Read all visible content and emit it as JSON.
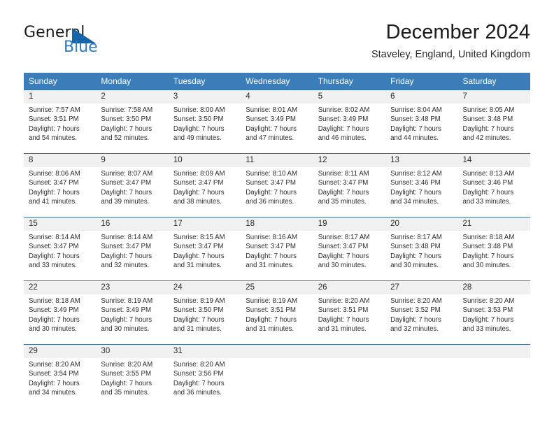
{
  "brand": {
    "word_one": "General",
    "word_two": "Blue",
    "triangle_icon": "brand-triangle-icon"
  },
  "header": {
    "title": "December 2024",
    "location": "Staveley, England, United Kingdom"
  },
  "theme": {
    "header_blue": "#3b7db9",
    "row_rule": "#41719c",
    "daynum_band": "#f0f0f0",
    "brand_blue": "#2b7cc4",
    "brand_triangle": "#1565a8"
  },
  "calendar": {
    "weekdays": [
      "Sunday",
      "Monday",
      "Tuesday",
      "Wednesday",
      "Thursday",
      "Friday",
      "Saturday"
    ],
    "weeks": [
      [
        {
          "day": "1",
          "text": "Sunrise: 7:57 AM\nSunset: 3:51 PM\nDaylight: 7 hours\nand 54 minutes."
        },
        {
          "day": "2",
          "text": "Sunrise: 7:58 AM\nSunset: 3:50 PM\nDaylight: 7 hours\nand 52 minutes."
        },
        {
          "day": "3",
          "text": "Sunrise: 8:00 AM\nSunset: 3:50 PM\nDaylight: 7 hours\nand 49 minutes."
        },
        {
          "day": "4",
          "text": "Sunrise: 8:01 AM\nSunset: 3:49 PM\nDaylight: 7 hours\nand 47 minutes."
        },
        {
          "day": "5",
          "text": "Sunrise: 8:02 AM\nSunset: 3:49 PM\nDaylight: 7 hours\nand 46 minutes."
        },
        {
          "day": "6",
          "text": "Sunrise: 8:04 AM\nSunset: 3:48 PM\nDaylight: 7 hours\nand 44 minutes."
        },
        {
          "day": "7",
          "text": "Sunrise: 8:05 AM\nSunset: 3:48 PM\nDaylight: 7 hours\nand 42 minutes."
        }
      ],
      [
        {
          "day": "8",
          "text": "Sunrise: 8:06 AM\nSunset: 3:47 PM\nDaylight: 7 hours\nand 41 minutes."
        },
        {
          "day": "9",
          "text": "Sunrise: 8:07 AM\nSunset: 3:47 PM\nDaylight: 7 hours\nand 39 minutes."
        },
        {
          "day": "10",
          "text": "Sunrise: 8:09 AM\nSunset: 3:47 PM\nDaylight: 7 hours\nand 38 minutes."
        },
        {
          "day": "11",
          "text": "Sunrise: 8:10 AM\nSunset: 3:47 PM\nDaylight: 7 hours\nand 36 minutes."
        },
        {
          "day": "12",
          "text": "Sunrise: 8:11 AM\nSunset: 3:47 PM\nDaylight: 7 hours\nand 35 minutes."
        },
        {
          "day": "13",
          "text": "Sunrise: 8:12 AM\nSunset: 3:46 PM\nDaylight: 7 hours\nand 34 minutes."
        },
        {
          "day": "14",
          "text": "Sunrise: 8:13 AM\nSunset: 3:46 PM\nDaylight: 7 hours\nand 33 minutes."
        }
      ],
      [
        {
          "day": "15",
          "text": "Sunrise: 8:14 AM\nSunset: 3:47 PM\nDaylight: 7 hours\nand 33 minutes."
        },
        {
          "day": "16",
          "text": "Sunrise: 8:14 AM\nSunset: 3:47 PM\nDaylight: 7 hours\nand 32 minutes."
        },
        {
          "day": "17",
          "text": "Sunrise: 8:15 AM\nSunset: 3:47 PM\nDaylight: 7 hours\nand 31 minutes."
        },
        {
          "day": "18",
          "text": "Sunrise: 8:16 AM\nSunset: 3:47 PM\nDaylight: 7 hours\nand 31 minutes."
        },
        {
          "day": "19",
          "text": "Sunrise: 8:17 AM\nSunset: 3:47 PM\nDaylight: 7 hours\nand 30 minutes."
        },
        {
          "day": "20",
          "text": "Sunrise: 8:17 AM\nSunset: 3:48 PM\nDaylight: 7 hours\nand 30 minutes."
        },
        {
          "day": "21",
          "text": "Sunrise: 8:18 AM\nSunset: 3:48 PM\nDaylight: 7 hours\nand 30 minutes."
        }
      ],
      [
        {
          "day": "22",
          "text": "Sunrise: 8:18 AM\nSunset: 3:49 PM\nDaylight: 7 hours\nand 30 minutes."
        },
        {
          "day": "23",
          "text": "Sunrise: 8:19 AM\nSunset: 3:49 PM\nDaylight: 7 hours\nand 30 minutes."
        },
        {
          "day": "24",
          "text": "Sunrise: 8:19 AM\nSunset: 3:50 PM\nDaylight: 7 hours\nand 31 minutes."
        },
        {
          "day": "25",
          "text": "Sunrise: 8:19 AM\nSunset: 3:51 PM\nDaylight: 7 hours\nand 31 minutes."
        },
        {
          "day": "26",
          "text": "Sunrise: 8:20 AM\nSunset: 3:51 PM\nDaylight: 7 hours\nand 31 minutes."
        },
        {
          "day": "27",
          "text": "Sunrise: 8:20 AM\nSunset: 3:52 PM\nDaylight: 7 hours\nand 32 minutes."
        },
        {
          "day": "28",
          "text": "Sunrise: 8:20 AM\nSunset: 3:53 PM\nDaylight: 7 hours\nand 33 minutes."
        }
      ],
      [
        {
          "day": "29",
          "text": "Sunrise: 8:20 AM\nSunset: 3:54 PM\nDaylight: 7 hours\nand 34 minutes."
        },
        {
          "day": "30",
          "text": "Sunrise: 8:20 AM\nSunset: 3:55 PM\nDaylight: 7 hours\nand 35 minutes."
        },
        {
          "day": "31",
          "text": "Sunrise: 8:20 AM\nSunset: 3:56 PM\nDaylight: 7 hours\nand 36 minutes."
        },
        {
          "day": "",
          "text": ""
        },
        {
          "day": "",
          "text": ""
        },
        {
          "day": "",
          "text": ""
        },
        {
          "day": "",
          "text": ""
        }
      ]
    ]
  }
}
